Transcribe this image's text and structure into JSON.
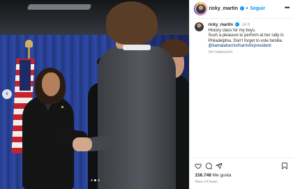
{
  "media": {
    "prev_icon": "chevron-left-icon",
    "prev_glyph": "‹",
    "carousel_count": 3,
    "carousel_index": 1
  },
  "header": {
    "username": "ricky_martin",
    "verified_icon": "verified-badge-icon",
    "verified_glyph": "✓",
    "separator": "•",
    "follow_label": "Seguir",
    "more_icon": "more-options-icon",
    "more_glyph": "•••"
  },
  "caption": {
    "username": "ricky_martin",
    "time": "14 h",
    "lines": [
      "History class for my boys.",
      "Such a pleasure to perform at her rally in Philadelphia. Don't forget to vote familia."
    ],
    "mention": "@kamalaharris",
    "hashtag": "#harrisforpresident",
    "translate_label": "Ver traducción"
  },
  "actions": {
    "like_icon": "heart-icon",
    "comment_icon": "comment-icon",
    "share_icon": "share-icon",
    "save_icon": "bookmark-icon"
  },
  "likes": {
    "count": "156.748",
    "label": "Me gusta"
  },
  "posted": "Hace 14 horas",
  "colors": {
    "link_blue": "#0095f6",
    "text_primary": "#262626",
    "text_secondary": "#8e8e8e",
    "curtain_blue": "#2f4aa6"
  }
}
